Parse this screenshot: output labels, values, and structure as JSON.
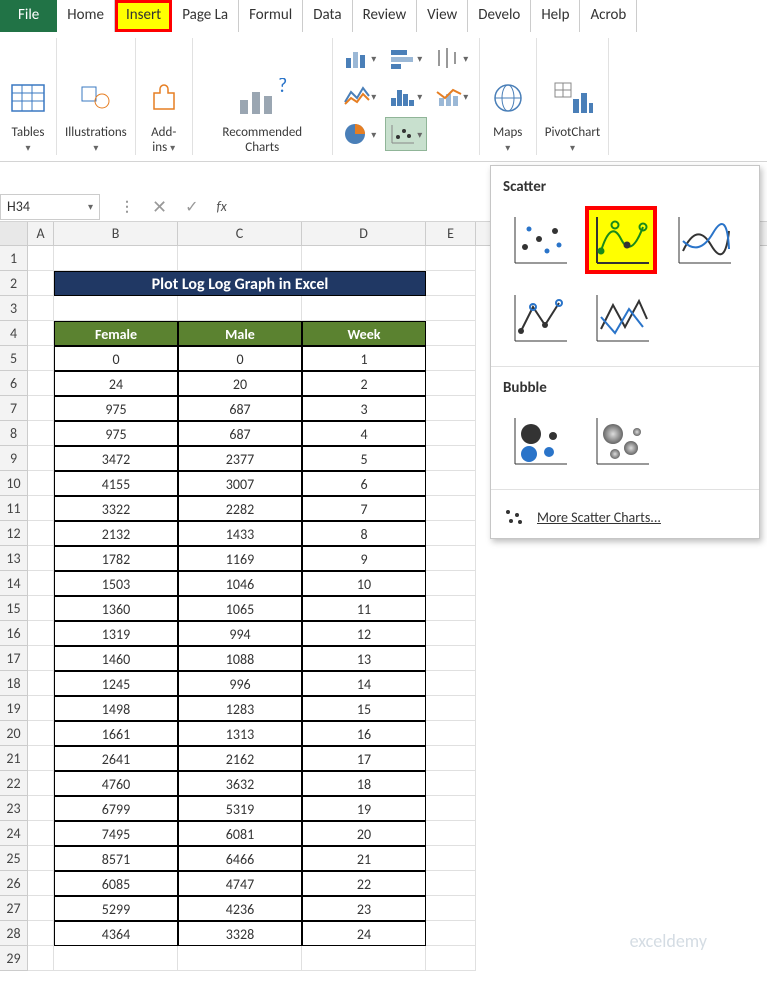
{
  "tabs": {
    "file": "File",
    "items": [
      "Home",
      "Insert",
      "Page La",
      "Formul",
      "Data",
      "Review",
      "View",
      "Develo",
      "Help",
      "Acrob"
    ],
    "highlighted_index": 1
  },
  "ribbon": {
    "tables": "Tables",
    "illustrations": "Illustrations",
    "addins": "Add-\nins",
    "recommended": "Recommended\nCharts",
    "maps": "Maps",
    "pivotchart": "PivotChart"
  },
  "namebox": "H34",
  "fx": "fx",
  "columns": [
    "A",
    "B",
    "C",
    "D",
    "E"
  ],
  "sheet_title": "Plot Log Log Graph in Excel",
  "headers": {
    "B": "Female",
    "C": "Male",
    "D": "Week"
  },
  "data_rows": [
    {
      "r": 5,
      "b": "0",
      "c": "0",
      "d": "1"
    },
    {
      "r": 6,
      "b": "24",
      "c": "20",
      "d": "2"
    },
    {
      "r": 7,
      "b": "975",
      "c": "687",
      "d": "3"
    },
    {
      "r": 8,
      "b": "975",
      "c": "687",
      "d": "4"
    },
    {
      "r": 9,
      "b": "3472",
      "c": "2377",
      "d": "5"
    },
    {
      "r": 10,
      "b": "4155",
      "c": "3007",
      "d": "6"
    },
    {
      "r": 11,
      "b": "3322",
      "c": "2282",
      "d": "7"
    },
    {
      "r": 12,
      "b": "2132",
      "c": "1433",
      "d": "8"
    },
    {
      "r": 13,
      "b": "1782",
      "c": "1169",
      "d": "9"
    },
    {
      "r": 14,
      "b": "1503",
      "c": "1046",
      "d": "10"
    },
    {
      "r": 15,
      "b": "1360",
      "c": "1065",
      "d": "11"
    },
    {
      "r": 16,
      "b": "1319",
      "c": "994",
      "d": "12"
    },
    {
      "r": 17,
      "b": "1460",
      "c": "1088",
      "d": "13"
    },
    {
      "r": 18,
      "b": "1245",
      "c": "996",
      "d": "14"
    },
    {
      "r": 19,
      "b": "1498",
      "c": "1283",
      "d": "15"
    },
    {
      "r": 20,
      "b": "1661",
      "c": "1313",
      "d": "16"
    },
    {
      "r": 21,
      "b": "2641",
      "c": "2162",
      "d": "17"
    },
    {
      "r": 22,
      "b": "4760",
      "c": "3632",
      "d": "18"
    },
    {
      "r": 23,
      "b": "6799",
      "c": "5319",
      "d": "19"
    },
    {
      "r": 24,
      "b": "7495",
      "c": "6081",
      "d": "20"
    },
    {
      "r": 25,
      "b": "8571",
      "c": "6466",
      "d": "21"
    },
    {
      "r": 26,
      "b": "6085",
      "c": "4747",
      "d": "22"
    },
    {
      "r": 27,
      "b": "5299",
      "c": "4236",
      "d": "23"
    },
    {
      "r": 28,
      "b": "4364",
      "c": "3328",
      "d": "24"
    }
  ],
  "dropdown": {
    "scatter_label": "Scatter",
    "bubble_label": "Bubble",
    "more_label": "More Scatter Charts..."
  },
  "watermark": "exceldemy"
}
